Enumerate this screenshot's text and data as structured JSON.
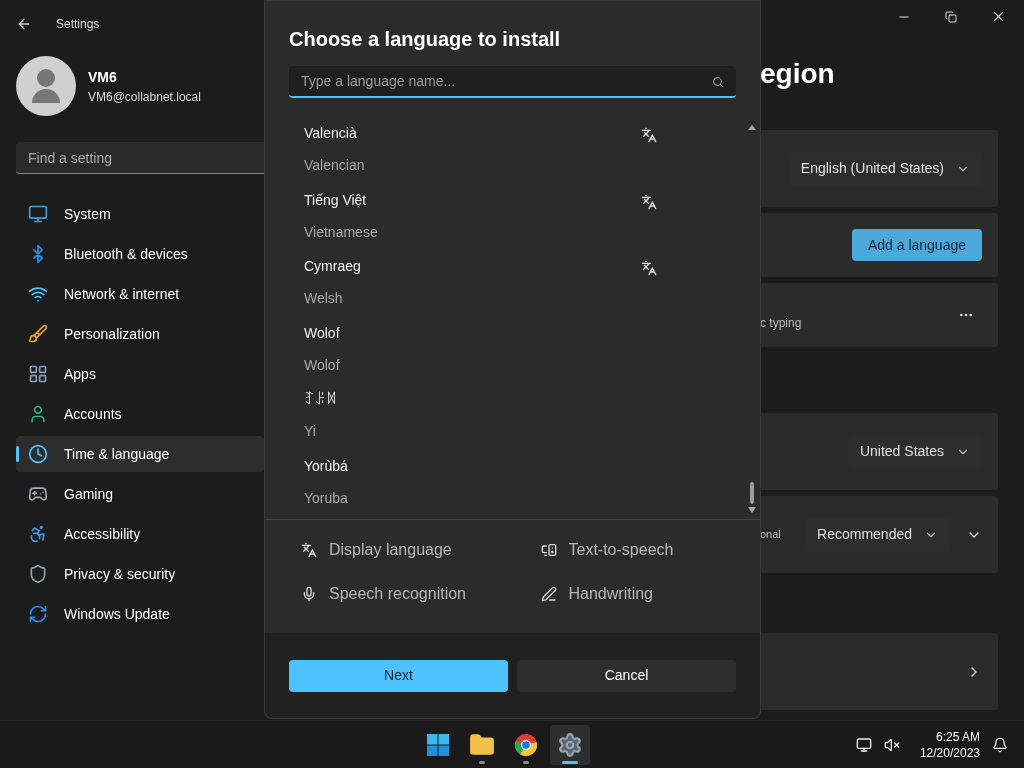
{
  "window": {
    "title": "Settings",
    "page_title_fragment": "egion"
  },
  "account": {
    "name": "VM6",
    "email": "VM6@collabnet.local"
  },
  "search": {
    "placeholder": "Find a setting"
  },
  "sidebar": {
    "items": [
      {
        "label": "System",
        "selected": false
      },
      {
        "label": "Bluetooth & devices",
        "selected": false
      },
      {
        "label": "Network & internet",
        "selected": false
      },
      {
        "label": "Personalization",
        "selected": false
      },
      {
        "label": "Apps",
        "selected": false
      },
      {
        "label": "Accounts",
        "selected": false
      },
      {
        "label": "Time & language",
        "selected": true
      },
      {
        "label": "Gaming",
        "selected": false
      },
      {
        "label": "Accessibility",
        "selected": false
      },
      {
        "label": "Privacy & security",
        "selected": false
      },
      {
        "label": "Windows Update",
        "selected": false
      }
    ]
  },
  "cards": [
    {
      "kind": "dropdown",
      "value": "English (United States)"
    },
    {
      "kind": "button",
      "label": "Add a language"
    },
    {
      "kind": "more",
      "text_fragment": "c typing"
    },
    {
      "kind": "dropdown",
      "value": "United States"
    },
    {
      "kind": "dropdown_expand",
      "text_fragment": "onal",
      "value": "Recommended"
    },
    {
      "kind": "link"
    }
  ],
  "dialog": {
    "title": "Choose a language to install",
    "search_placeholder": "Type a language name...",
    "languages": [
      {
        "native": "Valencià",
        "english": "Valencian",
        "display_language": true
      },
      {
        "native": "Tiếng Việt",
        "english": "Vietnamese",
        "display_language": true
      },
      {
        "native": "Cymraeg",
        "english": "Welsh",
        "display_language": true
      },
      {
        "native": "Wolof",
        "english": "Wolof",
        "display_language": false
      },
      {
        "native": "ꆈꌠꉙ",
        "english": "Yi",
        "display_language": false
      },
      {
        "native": "Yorùbá",
        "english": "Yoruba",
        "display_language": false
      }
    ],
    "features": [
      {
        "label": "Display language"
      },
      {
        "label": "Text-to-speech"
      },
      {
        "label": "Speech recognition"
      },
      {
        "label": "Handwriting"
      }
    ],
    "buttons": [
      {
        "label": "Next",
        "primary": true
      },
      {
        "label": "Cancel",
        "primary": false
      }
    ]
  },
  "taskbar": {
    "apps": [
      {
        "selected": false,
        "running": false
      },
      {
        "selected": false,
        "running": true
      },
      {
        "selected": false,
        "running": true
      },
      {
        "selected": true,
        "running": true
      }
    ],
    "time": "6:25 AM",
    "date": "12/20/2023"
  }
}
